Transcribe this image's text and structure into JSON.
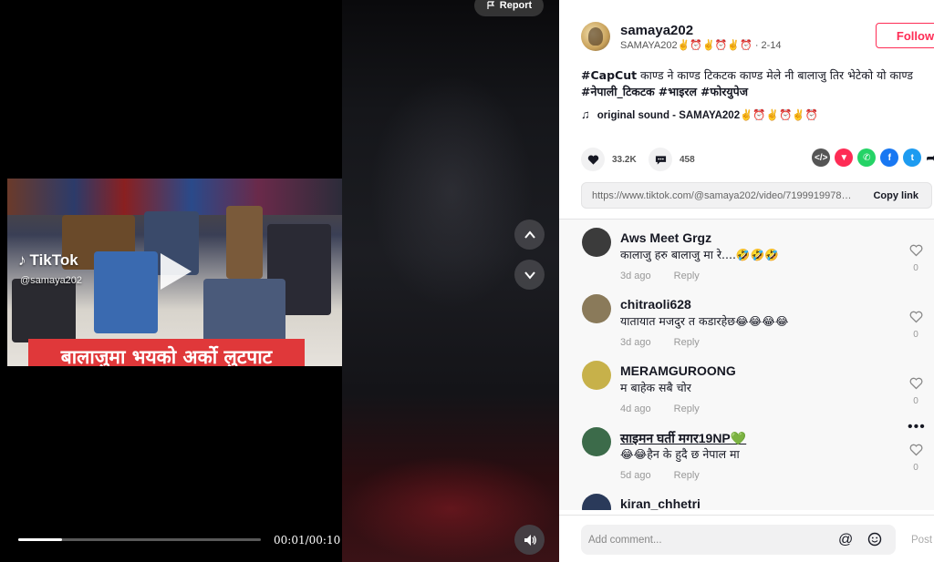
{
  "player": {
    "report_label": "Report",
    "watermark": "TikTok",
    "watermark_handle": "@samaya202",
    "video_caption": "बालाजुमा भयको अर्को लुटपाट",
    "time": "00:01/00:10",
    "progress_fraction": 0.18
  },
  "author": {
    "username": "samaya202",
    "display": "SAMAYA202✌️⏰✌️⏰✌️⏰",
    "date": "· 2-14",
    "follow_label": "Follow"
  },
  "description": {
    "tag1": "#CapCut",
    "text1": " काण्ड ने काण्ड टिकटक काण्ड मेले नी बालाजु तिर भेटेको यो काण्ड",
    "tag2": "#नेपाली_टिकटक",
    "tag3": "#भाइरल",
    "tag4": "#फोरयुपेज"
  },
  "music": {
    "icon": "♫",
    "label": "original sound - SAMAYA202✌️⏰✌️⏰✌️⏰"
  },
  "stats": {
    "likes": "33.2K",
    "comments": "458"
  },
  "share": {
    "link": "https://www.tiktok.com/@samaya202/video/719991997819...",
    "copy_label": "Copy link"
  },
  "comments": [
    {
      "name": "Aws Meet Grgz",
      "text": "कालाजु हरु बालाजु मा रे....🤣🤣🤣",
      "age": "3d ago",
      "reply": "Reply",
      "likes": "0",
      "avatar_color": "#3b3b3b"
    },
    {
      "name": "chitraoli628",
      "text": "यातायात मजदुर त कडारहेछ😂😂😂😂",
      "age": "3d ago",
      "reply": "Reply",
      "likes": "0",
      "avatar_color": "#8a7a5a"
    },
    {
      "name": "MERAMGUROONG",
      "text": "म बाहेक सबै चोर",
      "age": "4d ago",
      "reply": "Reply",
      "likes": "0",
      "avatar_color": "#c7b14a"
    },
    {
      "name": "साइमन घर्ती मगर19NP💚",
      "text": "😂😂हैन के हुदै छ नेपाल मा",
      "age": "5d ago",
      "reply": "Reply",
      "likes": "0",
      "avatar_color": "#3c6b4a"
    },
    {
      "name": "kiran_chhetri",
      "text": "",
      "age": "",
      "reply": "",
      "likes": "",
      "avatar_color": "#2a3a5a"
    }
  ],
  "composer": {
    "placeholder": "Add comment...",
    "at_symbol": "@",
    "post_label": "Post"
  },
  "colors": {
    "accent": "#fe2c55",
    "caption_red": "#e0383a"
  }
}
